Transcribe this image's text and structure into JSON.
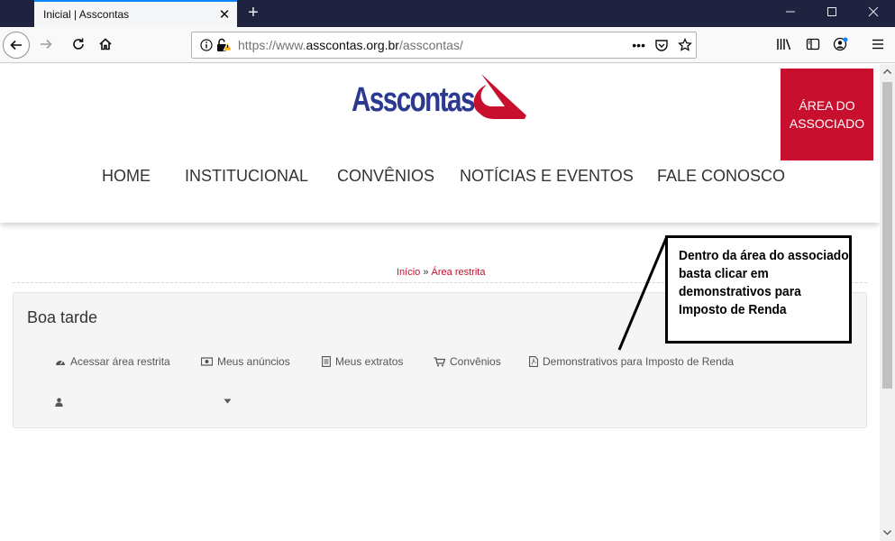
{
  "browser": {
    "tab_title": "Inicial | Asscontas",
    "tab_close": "✕",
    "new_tab": "+",
    "url_prefix": "https://www.",
    "url_host": "asscontas.org.br",
    "url_path": "/asscontas/",
    "page_actions": "•••",
    "icons": [
      "back-icon",
      "forward-icon",
      "reload-icon",
      "home-icon",
      "info-icon",
      "insecure-lock-icon",
      "pocket-icon",
      "bookmark-star-icon",
      "library-icon",
      "sidebar-icon",
      "account-icon",
      "menu-icon"
    ]
  },
  "site": {
    "logo_text": "Asscontas",
    "associate_button": "ÁREA DO ASSOCIADO",
    "menu": [
      "HOME",
      "INSTITUCIONAL",
      "CONVÊNIOS",
      "NOTÍCIAS E EVENTOS",
      "FALE CONOSCO"
    ],
    "brand_blue": "#2b3990",
    "brand_red": "#c8102e"
  },
  "breadcrumb": {
    "home": "Início",
    "separator": "»",
    "current": "Área restrita"
  },
  "panel": {
    "greeting": "Boa tarde",
    "links": [
      {
        "icon": "dashboard-icon",
        "label": "Acessar área restrita"
      },
      {
        "icon": "ads-icon",
        "label": "Meus anúncios"
      },
      {
        "icon": "document-icon",
        "label": "Meus extratos"
      },
      {
        "icon": "cart-icon",
        "label": "Convênios"
      },
      {
        "icon": "pdf-file-icon",
        "label": "Demonstrativos para Imposto de Renda"
      }
    ],
    "user_icon": "user-icon",
    "dropdown_icon": "caret-down-icon"
  },
  "callout": {
    "text": "Dentro da área do associado basta clicar em demonstrativos para Imposto de Renda"
  }
}
